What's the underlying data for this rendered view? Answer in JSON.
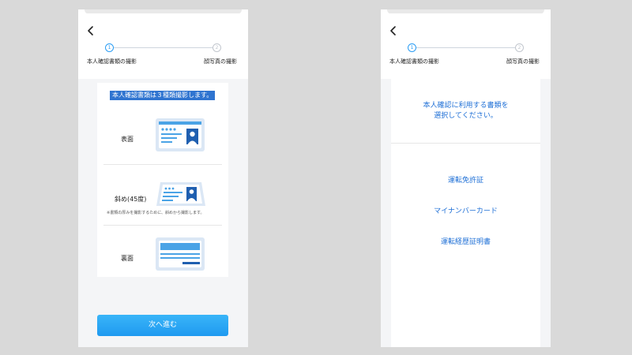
{
  "left_screen": {
    "steps": [
      {
        "number": "1",
        "label": "本人確認書類の撮影"
      },
      {
        "number": "2",
        "label": "顔写真の撮影"
      }
    ],
    "intro": "本人確認書類は３種類撮影します。",
    "documents": [
      {
        "label": "表面"
      },
      {
        "label": "斜め(45度)"
      },
      {
        "label": "裏面"
      }
    ],
    "note": "※書類の厚みを撮影するために、斜めから撮影します。",
    "next_button": "次へ進む"
  },
  "right_screen": {
    "steps": [
      {
        "number": "1",
        "label": "本人確認書類の撮影"
      },
      {
        "number": "2",
        "label": "顔写真の撮影"
      }
    ],
    "question_line1": "本人確認に利用する書類を",
    "question_line2": "選択してください。",
    "options": [
      {
        "label": "運転免許証"
      },
      {
        "label": "マイナンバーカード"
      },
      {
        "label": "運転経歴証明書"
      }
    ]
  },
  "colors": {
    "accent": "#2a9df4",
    "link": "#1e6fd6",
    "banner": "#2f74d0",
    "card_illustration_bg": "#dbe7f5"
  }
}
